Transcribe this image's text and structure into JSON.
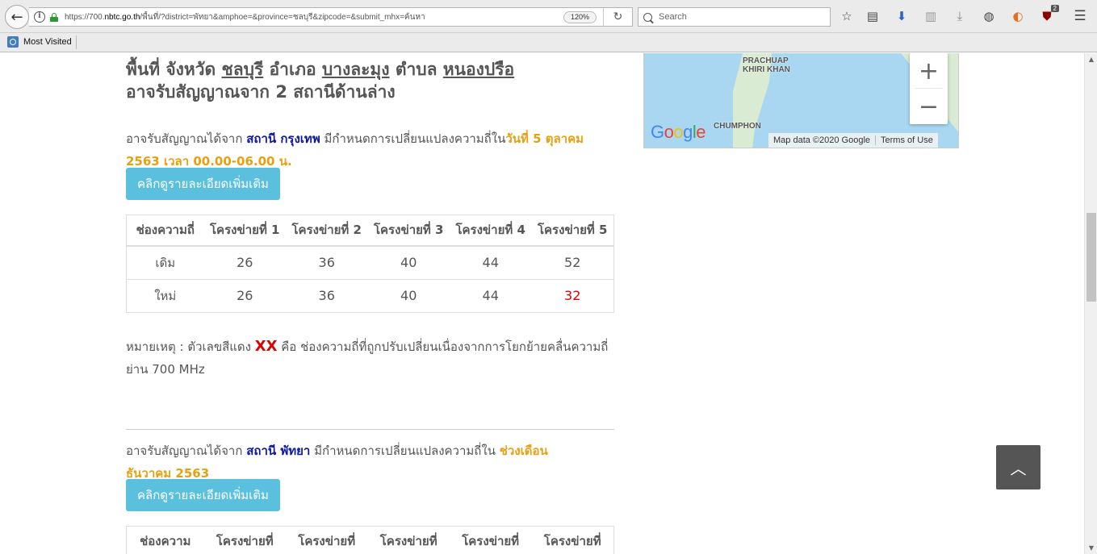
{
  "browser": {
    "url_prefix": "https://700.",
    "url_domain": "nbtc.go.th",
    "url_rest": "/พื้นที่/?district=พัทยา&amphoe=&province=ชลบุรี&zipcode=&submit_mhx=ค้นหา",
    "zoom": "120%",
    "search_placeholder": "Search",
    "bookmark_label": "Most Visited",
    "addon_badge": "2"
  },
  "heading": {
    "prefix": "พื้นที่   จังหวัด ",
    "province": "ชลบุรี",
    "amphoe_label": " อำเภอ ",
    "amphoe": "บางละมุง",
    "tambon_label": " ตำบล ",
    "tambon": "หนองปรือ",
    "line2": "อาจรับสัญญาณจาก 2 สถานีด้านล่าง"
  },
  "stations": [
    {
      "intro": "อาจรับสัญญาณได้จาก ",
      "station_name": "สถานี กรุงเทพ",
      "middle": " มีกำหนดการเปลี่ยนแปลงความถี่ใน",
      "date_text": "วันที่ 5 ตุลาคม 2563 เวลา 00.00-06.00 น.",
      "button_label": "คลิกดูรายละเอียดเพิ่มเติม",
      "table": {
        "headers": [
          "ช่องความถี่",
          "โครงข่ายที่ 1",
          "โครงข่ายที่ 2",
          "โครงข่ายที่ 3",
          "โครงข่ายที่ 4",
          "โครงข่ายที่ 5"
        ],
        "rows": [
          {
            "label": "เดิม",
            "values": [
              "26",
              "36",
              "40",
              "44",
              "52"
            ]
          },
          {
            "label": "ใหม่",
            "values": [
              "26",
              "36",
              "40",
              "44",
              "32"
            ]
          }
        ],
        "changed_column_index": 4
      }
    },
    {
      "intro": "อาจรับสัญญาณได้จาก ",
      "station_name": "สถานี พัทยา",
      "middle": " มีกำหนดการเปลี่ยนแปลงความถี่ใน ",
      "date_text": "ช่วงเดือน ธันวาคม 2563",
      "button_label": "คลิกดูรายละเอียดเพิ่มเติม",
      "table": {
        "headers": [
          "ช่องความ",
          "โครงข่ายที่",
          "โครงข่ายที่",
          "โครงข่ายที่",
          "โครงข่ายที่",
          "โครงข่ายที่"
        ]
      }
    }
  ],
  "note": {
    "prefix": "หมายเหตุ : ตัวเลขสีแดง ",
    "xx": "XX",
    "suffix": " คือ ช่องความถี่ที่ถูกปรับเปลี่ยนเนื่องจากการโยกย้ายคลื่นความถี่ย่าน 700 MHz"
  },
  "map": {
    "label_1_line1": "PRACHUAP",
    "label_1_line2": "KHIRI KHAN",
    "label_2": "CHUMPHON",
    "attribution": "Map data ©2020 Google",
    "terms": "Terms of Use",
    "zoom_in": "+",
    "zoom_out": "−"
  },
  "colors": {
    "station": "#0b18a6",
    "date": "#e8a010",
    "changed": "#e00000",
    "button": "#5bc0de"
  }
}
